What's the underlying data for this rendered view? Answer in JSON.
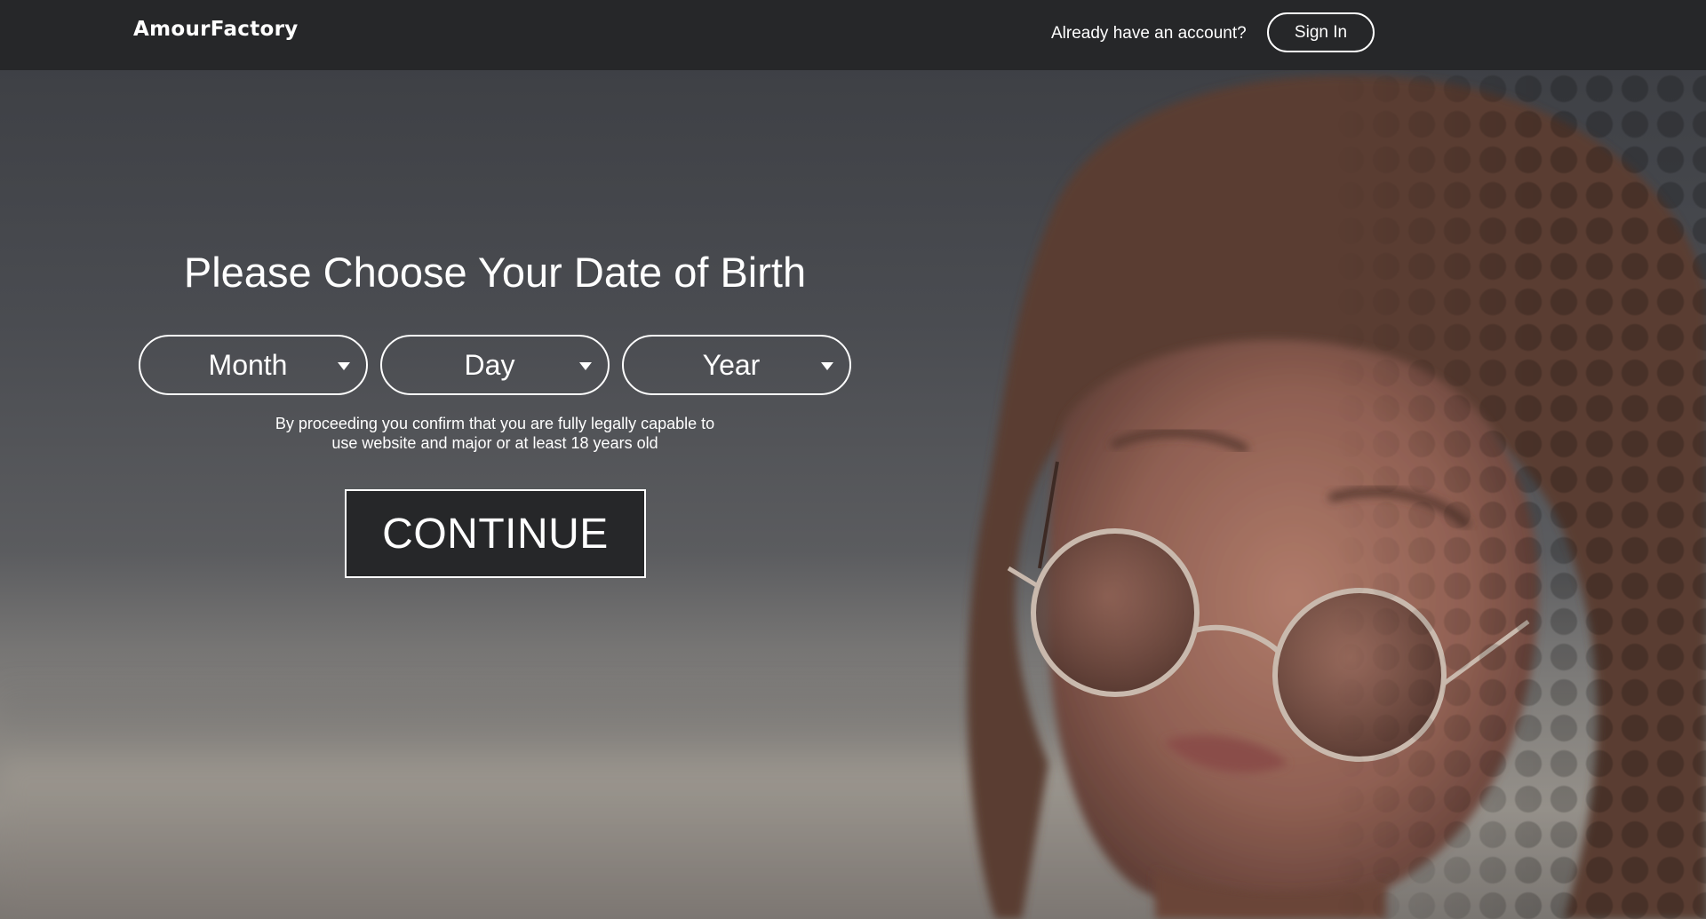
{
  "header": {
    "logo_text": "AmourFactory",
    "account_prompt": "Already have an account?",
    "signin_label": "Sign In"
  },
  "form": {
    "title": "Please Choose Your Date of Birth",
    "month_select": {
      "selected": "Month"
    },
    "day_select": {
      "selected": "Day"
    },
    "year_select": {
      "selected": "Year"
    },
    "disclaimer_line1": "By proceeding you confirm that you are fully legally capable to",
    "disclaimer_line2": "use website and major or at least 18 years old",
    "continue_label": "CONTINUE"
  },
  "colors": {
    "header_bg": "#262729",
    "text": "#ffffff",
    "button_bg": "#262729"
  },
  "icons": {
    "select_caret": "caret-down-icon"
  }
}
